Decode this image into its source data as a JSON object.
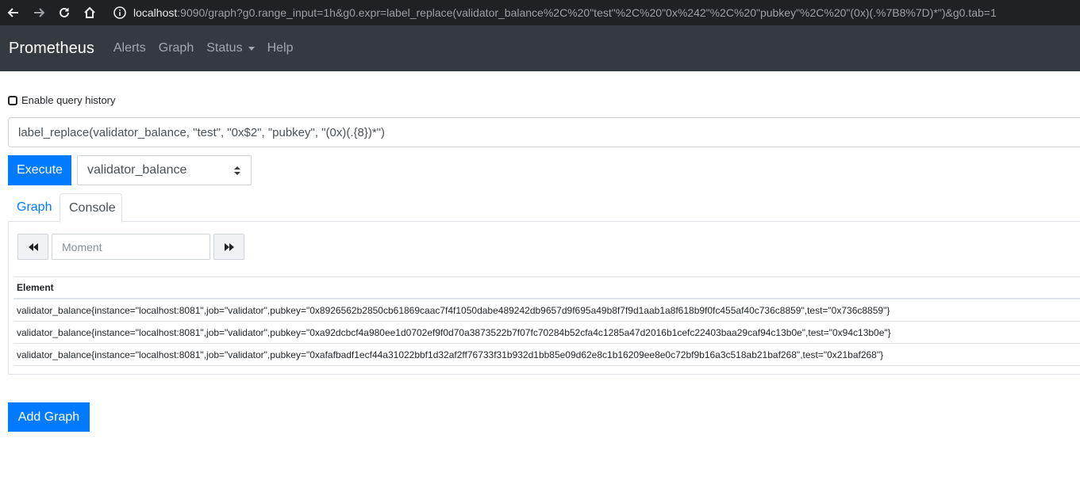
{
  "browser": {
    "url_host": "localhost",
    "url_rest": ":9090/graph?g0.range_input=1h&g0.expr=label_replace(validator_balance%2C%20\"test\"%2C%20\"0x%242\"%2C%20\"pubkey\"%2C%20\"(0x)(.%7B8%7D)*\")&g0.tab=1"
  },
  "navbar": {
    "brand": "Prometheus",
    "links": [
      "Alerts",
      "Graph",
      "Status",
      "Help"
    ]
  },
  "query_history": {
    "label": "Enable query history",
    "checked": false
  },
  "expression": {
    "value": "label_replace(validator_balance, \"test\", \"0x$2\", \"pubkey\", \"(0x)(.{8})*\")"
  },
  "controls": {
    "execute_label": "Execute",
    "metric_select": "validator_balance"
  },
  "tabs": [
    "Graph",
    "Console"
  ],
  "active_tab": "Console",
  "console": {
    "moment_placeholder": "Moment",
    "table": {
      "header": "Element",
      "rows": [
        "validator_balance{instance=\"localhost:8081\",job=\"validator\",pubkey=\"0x8926562b2850cb61869caac7f4f1050dabe489242db9657d9f695a49b8f7f9d1aab1a8f618b9f0fc455af40c736c8859\",test=\"0x736c8859\"}",
        "validator_balance{instance=\"localhost:8081\",job=\"validator\",pubkey=\"0xa92dcbcf4a980ee1d0702ef9f0d70a3873522b7f07fc70284b52cfa4c1285a47d2016b1cefc22403baa29caf94c13b0e\",test=\"0x94c13b0e\"}",
        "validator_balance{instance=\"localhost:8081\",job=\"validator\",pubkey=\"0xafafbadf1ecf44a31022bbf1d32af2ff76733f31b932d1bb85e09d62e8c1b16209ee8e0c72bf9b16a3c518ab21baf268\",test=\"0x21baf268\"}"
      ]
    }
  },
  "add_graph_label": "Add Graph",
  "colors": {
    "primary": "#007bff",
    "navbar": "#343a40",
    "browser_bar": "#202124"
  }
}
